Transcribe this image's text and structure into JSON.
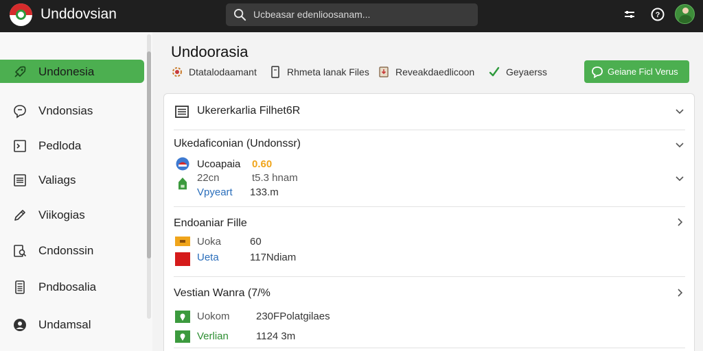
{
  "app": {
    "title": "Unddovsian"
  },
  "search": {
    "placeholder": "Ucbeasar edenlioosanam..."
  },
  "sidebar": {
    "items": [
      {
        "label": "Undonesia",
        "icon": "rocket-icon",
        "active": true
      },
      {
        "label": "Vndonsias",
        "icon": "chat-bubble-icon"
      },
      {
        "label": "Pedloda",
        "icon": "terminal-icon"
      },
      {
        "label": "Valiags",
        "icon": "list-icon"
      },
      {
        "label": "Viikogias",
        "icon": "pen-icon"
      },
      {
        "label": "Cndonssin",
        "icon": "document-search-icon"
      },
      {
        "label": "Pndbosalia",
        "icon": "calculator-icon"
      },
      {
        "label": "Undamsal",
        "icon": "user-circle-icon"
      }
    ]
  },
  "main": {
    "title": "Undoorasia",
    "actions": [
      {
        "label": "Dtatalodaamant",
        "icon": "gear-flower-icon"
      },
      {
        "label": "Rhmeta lanak Files",
        "icon": "file-icon"
      },
      {
        "label": "Reveakdaedlicoon",
        "icon": "download-doc-icon"
      },
      {
        "label": "Geyaerss",
        "icon": "checkmark-icon"
      }
    ],
    "primary_button": "Geiane Ficl Verus"
  },
  "panel": {
    "title": "Ukererkarlia Filhet6R",
    "section1": {
      "title": "Ukedaficonian (Undonssr)",
      "rows": [
        {
          "name": "Ucoapaia",
          "value": "0.60"
        },
        {
          "name": "22cn",
          "value": "t5.3 hnam"
        },
        {
          "name": "Vpyeart",
          "value": "133.m"
        }
      ]
    },
    "section2": {
      "title": "Endoaniar Fille",
      "rows": [
        {
          "name": "Uoka",
          "value": "60"
        },
        {
          "name": "Ueta",
          "value": "117Ndiam"
        }
      ]
    },
    "section3": {
      "title": "Vestian Wanra (7/%",
      "rows": [
        {
          "name": "Uokom",
          "value": "230FPolatgilaes"
        },
        {
          "name": "Verlian",
          "value": "1124 3m"
        }
      ]
    }
  },
  "colors": {
    "accent": "#4caf50",
    "topbar": "#1f1f1f",
    "value_orange": "#f0a51b",
    "row_blue": "#2a6ebb",
    "flag_red": "#d52b2b"
  }
}
